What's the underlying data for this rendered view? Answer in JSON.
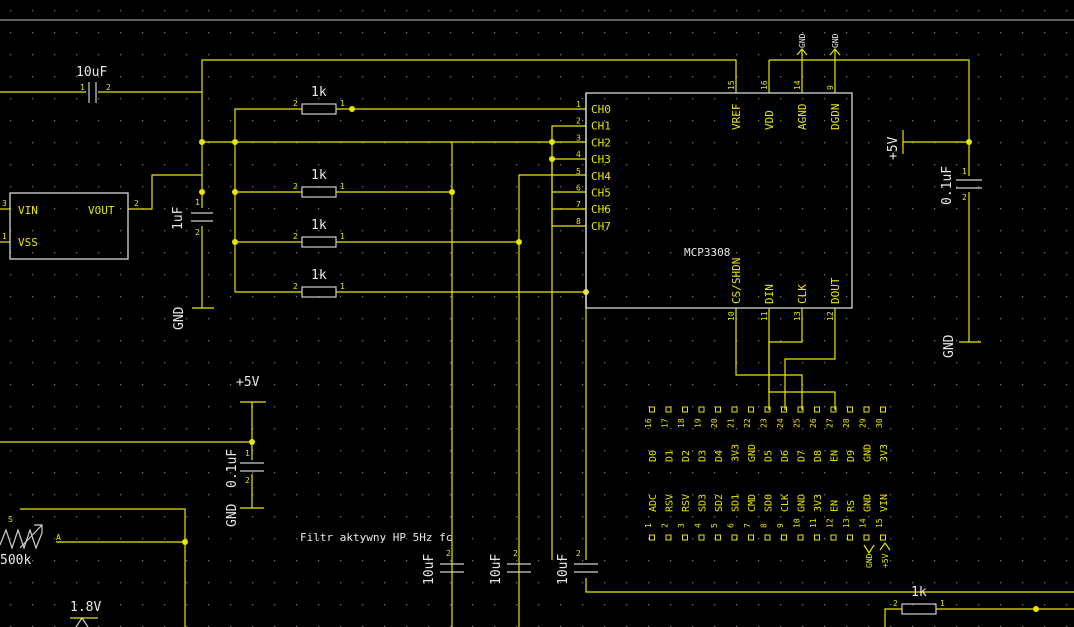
{
  "labels": {
    "cap_10uf_top": "10uF",
    "res_1k": "1k",
    "cap_1uf": "1uF",
    "cap_01uf": "0.1uF",
    "cap_10uf": "10uF",
    "gnd": "GND",
    "plus5v": "+5V",
    "pot": "500k",
    "v18": "1.8V",
    "filter_note": "Filtr aktywny HP 5Hz fc"
  },
  "regulator": {
    "pins": [
      "VIN",
      "VSS",
      "VOUT"
    ]
  },
  "adc": {
    "name": "MCP3308",
    "channels": [
      "CH0",
      "CH1",
      "CH2",
      "CH3",
      "CH4",
      "CH5",
      "CH6",
      "CH7"
    ],
    "top_pins": [
      "VREF",
      "VDD",
      "AGND",
      "DGDN"
    ],
    "bottom_pins": [
      "CS/SHDN",
      "DIN",
      "CLK",
      "DOUT"
    ]
  },
  "header_top": {
    "labels": [
      "D0",
      "D1",
      "D2",
      "D3",
      "D4",
      "3V3",
      "GND",
      "D5",
      "D6",
      "D7",
      "D8",
      "EN",
      "D9",
      "GND",
      "3V3"
    ],
    "numbers": [
      "16",
      "17",
      "18",
      "19",
      "20",
      "21",
      "22",
      "23",
      "24",
      "25",
      "26",
      "27",
      "28",
      "29",
      "30"
    ]
  },
  "header_bottom": {
    "labels": [
      "ADC",
      "RSV",
      "RSV",
      "SD3",
      "SD2",
      "SD1",
      "CMD",
      "SD0",
      "CLK",
      "GND",
      "3V3",
      "EN",
      "RS",
      "GND",
      "VIN"
    ],
    "numbers": [
      "1",
      "2",
      "3",
      "4",
      "5",
      "6",
      "7",
      "8",
      "9",
      "10",
      "11",
      "12",
      "13",
      "14",
      "15"
    ]
  },
  "pin_numbers": {
    "adc_left": [
      "1",
      "2",
      "3",
      "4",
      "5",
      "6",
      "7",
      "8"
    ],
    "adc_top": [
      "15",
      "16",
      "14",
      "9"
    ],
    "adc_bottom": [
      "10",
      "11",
      "13",
      "12"
    ]
  },
  "colors": {
    "background": "#000000",
    "wire": "#e6e600",
    "symbol": "#d8d8d8"
  }
}
